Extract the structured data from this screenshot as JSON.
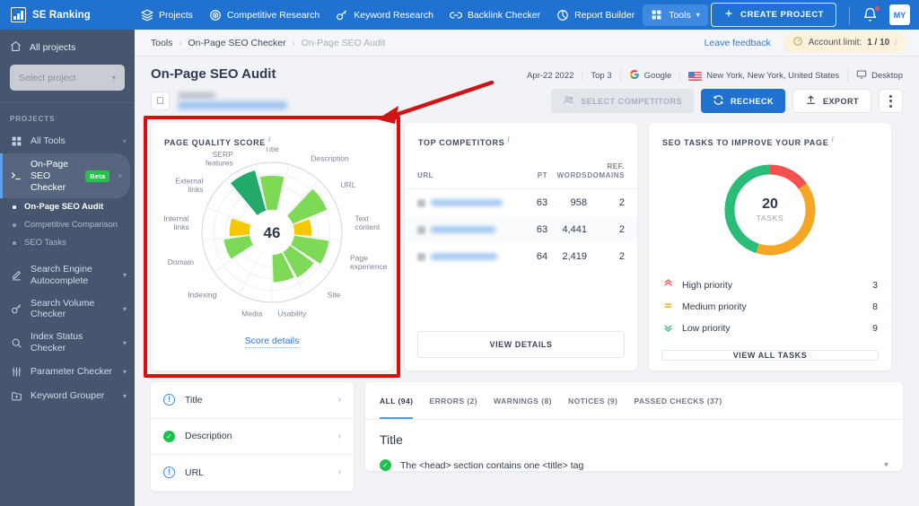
{
  "topnav": {
    "brand": "SE Ranking",
    "items": [
      {
        "label": "Projects",
        "icon": "layers-icon"
      },
      {
        "label": "Competitive Research",
        "icon": "target-icon"
      },
      {
        "label": "Keyword Research",
        "icon": "key-icon"
      },
      {
        "label": "Backlink Checker",
        "icon": "link-icon"
      },
      {
        "label": "Report Builder",
        "icon": "pie-chart-icon"
      },
      {
        "label": "Tools",
        "icon": "grid-icon"
      }
    ],
    "create_button": "CREATE PROJECT",
    "avatar": "MY"
  },
  "sidebar": {
    "all_projects": "All projects",
    "select_placeholder": "Select project",
    "section_label": "PROJECTS",
    "items": [
      {
        "label": "All Tools",
        "icon": "grid-icon",
        "chevron": "˅"
      },
      {
        "label": "On-Page SEO Checker",
        "icon": "terminal-icon",
        "badge": "Beta",
        "chevron": "˄"
      }
    ],
    "sub_items": [
      {
        "label": "On-Page SEO Audit",
        "current": true
      },
      {
        "label": "Competitive Comparison",
        "current": false
      },
      {
        "label": "SEO Tasks",
        "current": false
      }
    ],
    "tools": [
      {
        "label": "Search Engine Autocomplete",
        "icon": "pen-icon"
      },
      {
        "label": "Search Volume Checker",
        "icon": "key-icon"
      },
      {
        "label": "Index Status Checker",
        "icon": "search-icon"
      },
      {
        "label": "Parameter Checker",
        "icon": "sliders-icon"
      },
      {
        "label": "Keyword Grouper",
        "icon": "folder-plus-icon"
      }
    ]
  },
  "breadcrumb": {
    "items": [
      "Tools",
      "On-Page SEO Checker",
      "On-Page SEO Audit"
    ],
    "separator": "›",
    "feedback": "Leave feedback",
    "account_limit": "Account limit: ",
    "account_limit_value": "1 / 10",
    "info_marker": "i"
  },
  "page": {
    "title": "On-Page SEO Audit",
    "meta": [
      {
        "label": "Apr-22 2022",
        "icon": ""
      },
      {
        "label": "Top 3",
        "icon": ""
      },
      {
        "label": "Google",
        "icon": "google-icon"
      },
      {
        "label": "New York, New York, United States",
        "icon": "flag-us-icon"
      },
      {
        "label": "Desktop",
        "icon": "monitor-icon"
      }
    ],
    "actions": [
      {
        "label": "SELECT COMPETITORS",
        "icon": "users-icon",
        "style": "ghost"
      },
      {
        "label": "RECHECK",
        "icon": "refresh-icon",
        "style": "blue"
      },
      {
        "label": "EXPORT",
        "icon": "upload-icon",
        "style": "white"
      }
    ],
    "kebab": "more-options"
  },
  "page_quality": {
    "title": "PAGE QUALITY SCORE",
    "info_marker": "i",
    "score_details_link": "Score details"
  },
  "competitors": {
    "title": "TOP COMPETITORS",
    "info_marker": "i",
    "columns": [
      "URL",
      "PT",
      "WORDS",
      "REF. DOMAINS"
    ],
    "rows": [
      {
        "url": "",
        "pt": "63",
        "words": "958",
        "ref_domains": "2"
      },
      {
        "url": "",
        "pt": "63",
        "words": "4,441",
        "ref_domains": "2"
      },
      {
        "url": "",
        "pt": "64",
        "words": "2,419",
        "ref_domains": "2"
      }
    ],
    "view_details": "VIEW DETAILS"
  },
  "seo_tasks": {
    "title": "SEO TASKS TO IMPROVE YOUR PAGE",
    "info_marker": "i",
    "total": "20",
    "total_label": "TASKS",
    "priorities": [
      {
        "name": "High priority",
        "count": "3",
        "icon": "chevrons-up-icon",
        "color": "#f4514e"
      },
      {
        "name": "Medium priority",
        "count": "8",
        "icon": "equals-icon",
        "color": "#f5a623"
      },
      {
        "name": "Low priority",
        "count": "9",
        "icon": "chevrons-down-icon",
        "color": "#2bbd77"
      }
    ],
    "view_all": "VIEW ALL TASKS"
  },
  "checks_list": [
    {
      "label": "Title",
      "status": "warning"
    },
    {
      "label": "Description",
      "status": "ok"
    },
    {
      "label": "URL",
      "status": "warning"
    }
  ],
  "detail": {
    "tabs": [
      {
        "label": "ALL (94)",
        "active": true
      },
      {
        "label": "ERRORS (2)",
        "active": false
      },
      {
        "label": "WARNINGS (8)",
        "active": false
      },
      {
        "label": "NOTICES (9)",
        "active": false
      },
      {
        "label": "PASSED CHECKS (37)",
        "active": false
      }
    ],
    "section_title": "Title",
    "items": [
      {
        "text": "The <head> section contains one <title> tag",
        "status": "ok"
      }
    ]
  },
  "chart_data": [
    {
      "type": "bar",
      "subtype": "radial-polar",
      "title": "PAGE QUALITY SCORE",
      "center_value": 46,
      "max": 100,
      "rings": 4,
      "categories": [
        "Title",
        "Description",
        "URL",
        "Text content",
        "Page experience",
        "Site",
        "Usability",
        "Media",
        "Indexing",
        "Domain",
        "Internal links",
        "External links",
        "SERP features"
      ],
      "values": [
        72,
        0,
        78,
        36,
        74,
        62,
        58,
        0,
        0,
        55,
        42,
        0,
        88
      ],
      "colors": [
        "#7ed957",
        "#7ed957",
        "#7ed957",
        "#f7c800",
        "#7ed957",
        "#7ed957",
        "#7ed957",
        "#7ed957",
        "#7ed957",
        "#7ed957",
        "#f7c800",
        "#f7c800",
        "#23a96a"
      ],
      "grid": true,
      "legend": false
    },
    {
      "type": "pie",
      "subtype": "donut",
      "title": "SEO TASKS TO IMPROVE YOUR PAGE",
      "center_value": 20,
      "center_label": "TASKS",
      "categories": [
        "High priority",
        "Medium priority",
        "Low priority"
      ],
      "values": [
        3,
        8,
        9
      ],
      "colors": [
        "#f4514e",
        "#f5a623",
        "#2bbd77"
      ],
      "legend": "bottom"
    },
    {
      "type": "table",
      "title": "TOP COMPETITORS",
      "columns": [
        "URL",
        "PT",
        "WORDS",
        "REF. DOMAINS"
      ],
      "rows": [
        [
          "",
          "63",
          "958",
          "2"
        ],
        [
          "",
          "63",
          "4,441",
          "2"
        ],
        [
          "",
          "64",
          "2,419",
          "2"
        ]
      ]
    }
  ]
}
